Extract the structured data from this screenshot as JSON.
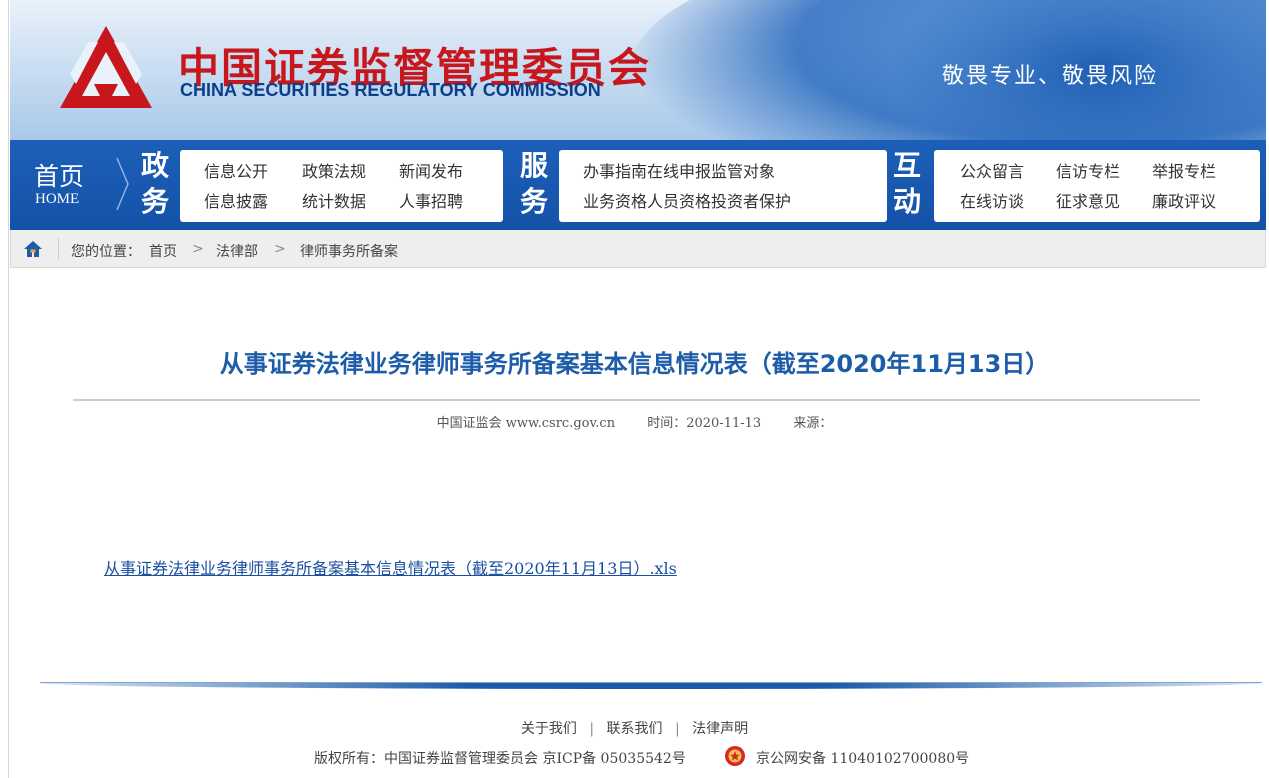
{
  "header": {
    "cn_name": "中国证券监督管理委员会",
    "en_name": "CHINA SECURITIES REGULATORY COMMISSION",
    "slogan": "敬畏专业、敬畏风险"
  },
  "nav": {
    "home_cn": "首页",
    "home_en": "HOME",
    "sections": [
      {
        "title_1": "政",
        "title_2": "务",
        "links": [
          "信息公开",
          "政策法规",
          "新闻发布",
          "信息披露",
          "统计数据",
          "人事招聘"
        ]
      },
      {
        "title_1": "服",
        "title_2": "务",
        "links": [
          "办事指南",
          "在线申报",
          "监管对象",
          "业务资格",
          "人员资格",
          "投资者保护"
        ]
      },
      {
        "title_1": "互",
        "title_2": "动",
        "links": [
          "公众留言",
          "信访专栏",
          "举报专栏",
          "在线访谈",
          "征求意见",
          "廉政评议"
        ]
      }
    ]
  },
  "breadcrumb": {
    "prefix": "您的位置：",
    "items": [
      "首页",
      "法律部",
      "律师事务所备案"
    ],
    "separator": ">"
  },
  "article": {
    "title": "从事证券法律业务律师事务所备案基本信息情况表（截至2020年11月13日）",
    "source": "中国证监会 www.csrc.gov.cn",
    "time": "时间：2020-11-13",
    "origin": "来源：",
    "attachment": "从事证券法律业务律师事务所备案基本信息情况表（截至2020年11月13日）.xls"
  },
  "footer": {
    "links": [
      "关于我们",
      "联系我们",
      "法律声明"
    ],
    "link_separator": "|",
    "copyright": "版权所有：中国证券监督管理委员会 京ICP备 05035542号",
    "beian": "京公网安备 11040102700080号"
  },
  "colors": {
    "brand_red": "#c8161d",
    "brand_blue": "#1d5ca8",
    "nav_blue": "#1452a8"
  }
}
